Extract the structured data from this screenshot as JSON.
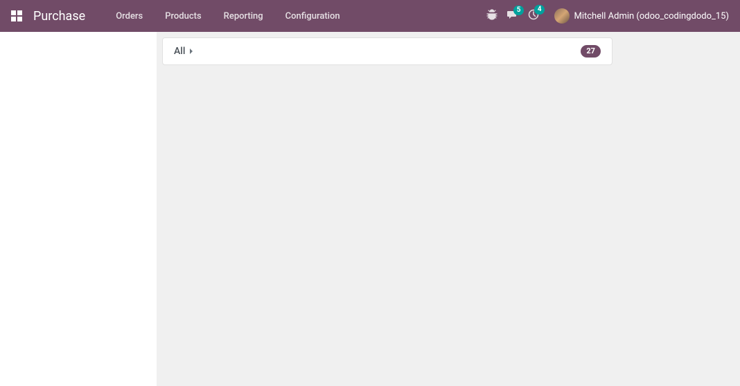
{
  "header": {
    "app_title": "Purchase",
    "menu": [
      {
        "label": "Orders"
      },
      {
        "label": "Products"
      },
      {
        "label": "Reporting"
      },
      {
        "label": "Configuration"
      }
    ],
    "discuss_badge": "5",
    "activity_badge": "4",
    "user_name": "Mitchell Admin (odoo_codingdodo_15)"
  },
  "main": {
    "category": {
      "label": "All",
      "count": "27"
    }
  }
}
